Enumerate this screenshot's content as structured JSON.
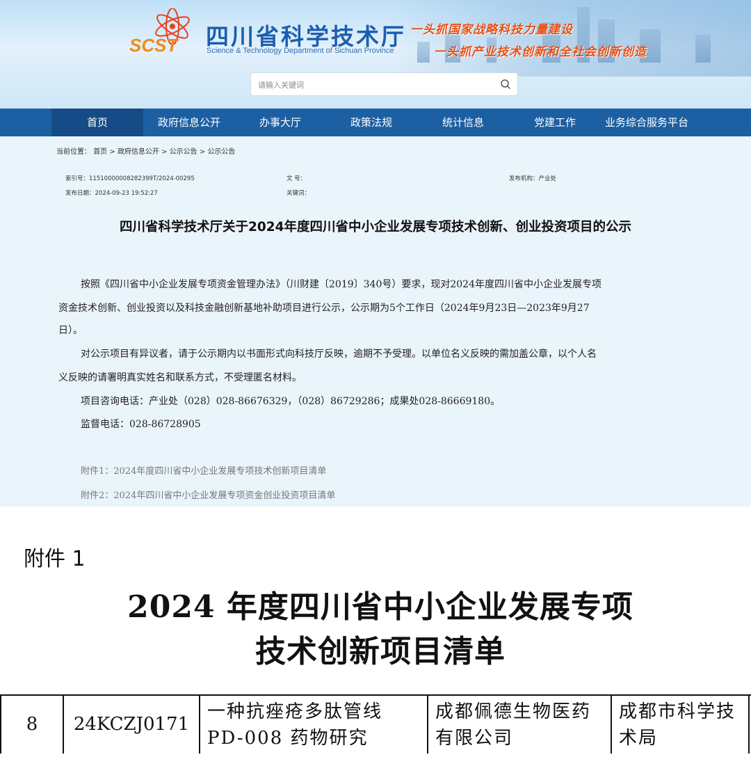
{
  "header": {
    "logo_text": "SCST",
    "title": "四川省科学技术厅",
    "subtitle": "Science & Technology Department of Sichuan Province",
    "slogan_1": "一头抓国家战略科技力量建设",
    "slogan_2": "一头抓产业技术创新和全社会创新创造"
  },
  "search": {
    "placeholder": "请输入关键词"
  },
  "nav": {
    "items": [
      "首页",
      "政府信息公开",
      "办事大厅",
      "政策法规",
      "统计信息",
      "党建工作",
      "业务综合服务平台"
    ],
    "active": "首页"
  },
  "breadcrumb": {
    "prefix": "当前位置：",
    "items": [
      "首页",
      "政府信息公开",
      "公示公告",
      "公示公告"
    ],
    "separator": " > "
  },
  "meta": {
    "index_label": "索引号：",
    "index_value": "11510000008282399T/2024-00295",
    "docno_label": "文 号：",
    "docno_value": "",
    "publisher_label": "发布机构：",
    "publisher_value": "产业处",
    "date_label": "发布日期：",
    "date_value": "2024-09-23 19:52:27",
    "keywords_label": "关键词：",
    "keywords_value": ""
  },
  "article": {
    "title": "四川省科学技术厅关于2024年度四川省中小企业发展专项技术创新、创业投资项目的公示",
    "p1_line1": "按照《四川省中小企业发展专项资金管理办法》（川财建〔2019〕340号）要求，现对2024年度四川省中小企业发展专项",
    "p1_line2": "资金技术创新、创业投资以及科技金融创新基地补助项目进行公示，公示期为5个工作日（2024年9月23日—2023年9月27",
    "p1_line3": "日）。",
    "p2_line1": "对公示项目有异议者，请于公示期内以书面形式向科技厅反映，逾期不予受理。以单位名义反映的需加盖公章，以个人名",
    "p2_line2": "义反映的请署明真实姓名和联系方式，不受理匿名材料。",
    "p3": "项目咨询电话：产业处（028）028-86676329，（028）86729286；成果处028-86669180。",
    "p4": "监督电话：028-86728905",
    "attachments": [
      "附件1：2024年度四川省中小企业发展专项技术创新项目清单",
      "附件2：2024年四川省中小企业发展专项资金创业投资项目清单"
    ]
  },
  "attachment_scan": {
    "label": "附件 1",
    "title_line1": "2024 年度四川省中小企业发展专项",
    "title_line2": "技术创新项目清单",
    "row": {
      "no": "8",
      "code": "24KCZJ0171",
      "project_line1": "一种抗痤疮多肽管线",
      "project_line2": "PD-008 药物研究",
      "company_line1": "成都佩德生物医药",
      "company_line2": "有限公司",
      "authority_line1": "成都市科学技",
      "authority_line2": "术局"
    }
  },
  "colors": {
    "nav_bg": "#1d5fa3",
    "nav_active": "#154b86",
    "content_bg": "#eaf4fb",
    "slogan": "#e84f14",
    "title_blue": "#1d5fae"
  }
}
